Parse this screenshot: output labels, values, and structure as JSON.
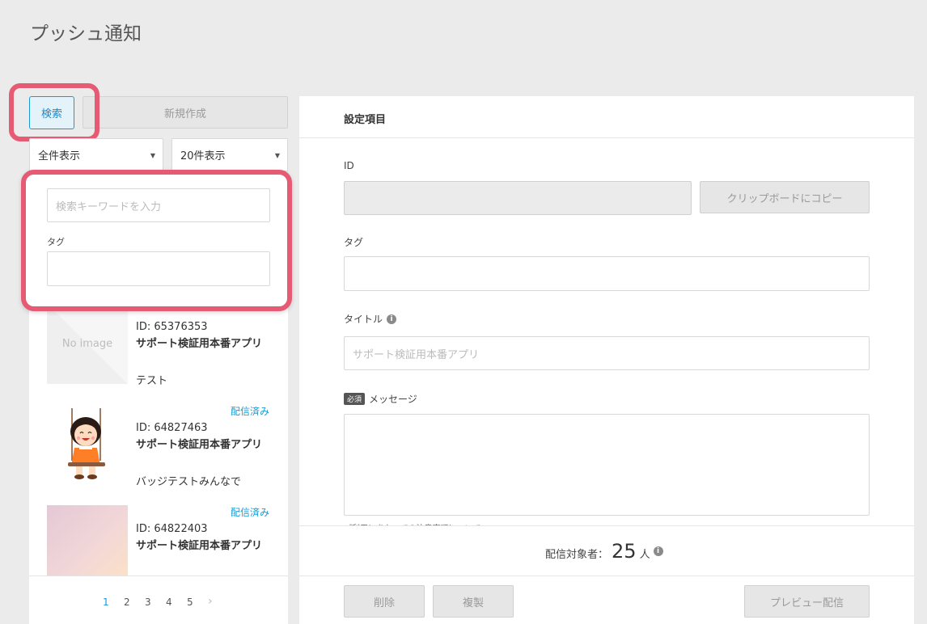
{
  "page": {
    "title": "プッシュ通知"
  },
  "toolbar": {
    "search_label": "検索",
    "new_label": "新規作成"
  },
  "filters": {
    "display": "全件表示",
    "count": "20件表示"
  },
  "search_popup": {
    "keyword_placeholder": "検索キーワードを入力",
    "tag_label": "タグ",
    "tag_value": ""
  },
  "list": {
    "items": [
      {
        "thumb_text": "No image",
        "status": "",
        "id": "ID: 65376353",
        "app": "サポート検証用本番アプリ",
        "message": "テスト"
      },
      {
        "thumb_text": "",
        "status": "配信済み",
        "id": "ID: 64827463",
        "app": "サポート検証用本番アプリ",
        "message": "バッジテストみんなで"
      },
      {
        "thumb_text": "",
        "status": "配信済み",
        "id": "ID: 64822403",
        "app": "サポート検証用本番アプリ",
        "message": ""
      }
    ]
  },
  "pagination": {
    "pages": [
      "1",
      "2",
      "3",
      "4",
      "5"
    ],
    "current": "1",
    "next": "›"
  },
  "settings": {
    "header": "設定項目",
    "id_label": "ID",
    "id_value": "",
    "copy_button": "クリップボードにコピー",
    "tag_label": "タグ",
    "title_label": "タイトル",
    "title_placeholder": "サポート検証用本番アプリ",
    "required_badge": "必須",
    "message_label": "メッセージ",
    "hint_text": "ご利用にあたっての注意事項について",
    "target_label": "配信対象者：",
    "target_count": "25",
    "target_unit": "人",
    "delete_button": "削除",
    "duplicate_button": "複製",
    "preview_button": "プレビュー配信"
  },
  "colors": {
    "accent": "#1a9bd0",
    "highlight": "#e75a73",
    "background": "#ebebeb"
  }
}
